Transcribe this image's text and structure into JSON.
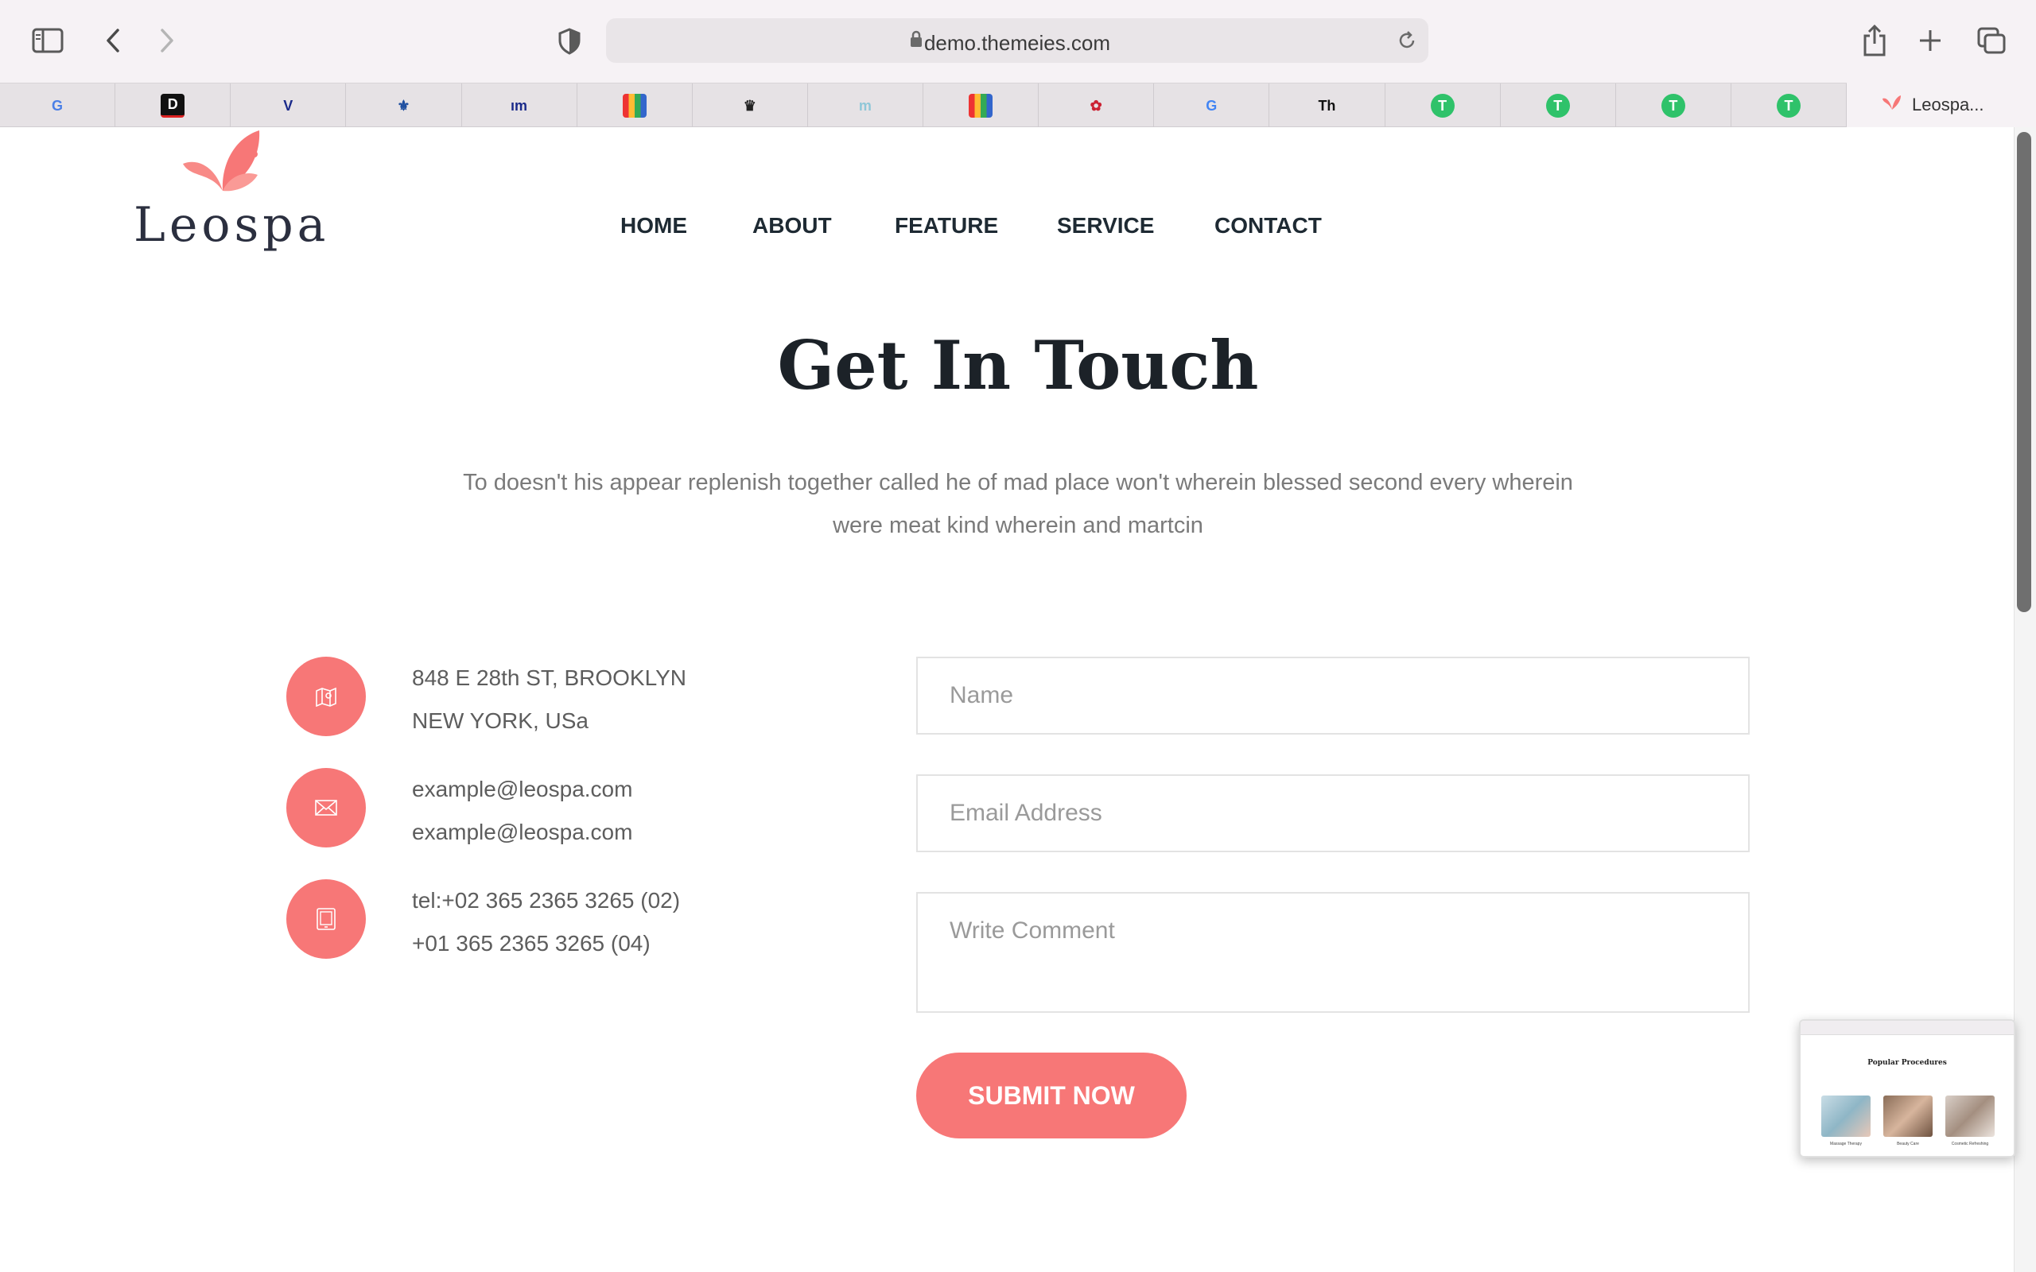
{
  "browser": {
    "url": "demo.themeies.com",
    "active_tab_title": "Leospa...",
    "toolbar_icons": [
      "sidebar-icon",
      "back-arrow-icon",
      "forward-arrow-icon",
      "shield-icon",
      "lock-icon",
      "reload-icon",
      "share-icon",
      "plus-icon",
      "tabs-overview-icon"
    ],
    "favorites": [
      {
        "icon": "google-translate-icon",
        "text": "G",
        "color": "#4a7fe6"
      },
      {
        "icon": "d-letter-icon",
        "text": "D",
        "color": "#111111"
      },
      {
        "icon": "checkmark-v-icon",
        "text": "V",
        "color": "#1a2a8a"
      },
      {
        "icon": "fleur-emblem-icon",
        "text": "⚜",
        "color": "#1e4fa0"
      },
      {
        "icon": "mm-logo-icon",
        "text": "ım",
        "color": "#1a2a8a"
      },
      {
        "icon": "color-grid-icon",
        "text": "",
        "color": "#cc3344"
      },
      {
        "icon": "eagle-crest-icon",
        "text": "♛",
        "color": "#222222"
      },
      {
        "icon": "mbe-logo-icon",
        "text": "m",
        "color": "#8fc7d8"
      },
      {
        "icon": "color-grid-icon",
        "text": "",
        "color": "#cc3344"
      },
      {
        "icon": "crest-seal-icon",
        "text": "✿",
        "color": "#cc2233"
      },
      {
        "icon": "google-g-icon",
        "text": "G",
        "color": "#4285f4"
      },
      {
        "icon": "th-logo-icon",
        "text": "Th",
        "color": "#111111"
      },
      {
        "icon": "green-t-icon",
        "text": "T",
        "color": "#2fc26a"
      },
      {
        "icon": "green-t-icon",
        "text": "T",
        "color": "#2fc26a"
      },
      {
        "icon": "green-t-icon",
        "text": "T",
        "color": "#2fc26a"
      },
      {
        "icon": "green-t-icon",
        "text": "T",
        "color": "#2fc26a"
      }
    ]
  },
  "site": {
    "logo_text": "Leospa",
    "brand_color": "#f77777",
    "nav": [
      "HOME",
      "ABOUT",
      "FEATURE",
      "SERVICE",
      "CONTACT"
    ]
  },
  "contact": {
    "heading": "Get In Touch",
    "subtext": "To doesn't his appear replenish together called he of mad place won't wherein blessed second every wherein were meat kind wherein and martcin",
    "info": [
      {
        "icon": "map-icon",
        "lines": [
          "848 E 28th ST, BROOKLYN",
          "NEW YORK, USa"
        ]
      },
      {
        "icon": "envelope-icon",
        "lines": [
          "example@leospa.com",
          "example@leospa.com"
        ]
      },
      {
        "icon": "tablet-icon",
        "lines": [
          "tel:+02 365 2365 3265 (02)",
          "+01 365 2365 3265 (04)"
        ]
      }
    ],
    "form": {
      "name_placeholder": "Name",
      "email_placeholder": "Email Address",
      "comment_placeholder": "Write Comment",
      "submit_label": "SUBMIT NOW"
    }
  },
  "thumbnail": {
    "title": "Popular Procedures",
    "captions": [
      "Massage Therapy",
      "Beauty Care",
      "Cosmetic Refreshing"
    ]
  }
}
